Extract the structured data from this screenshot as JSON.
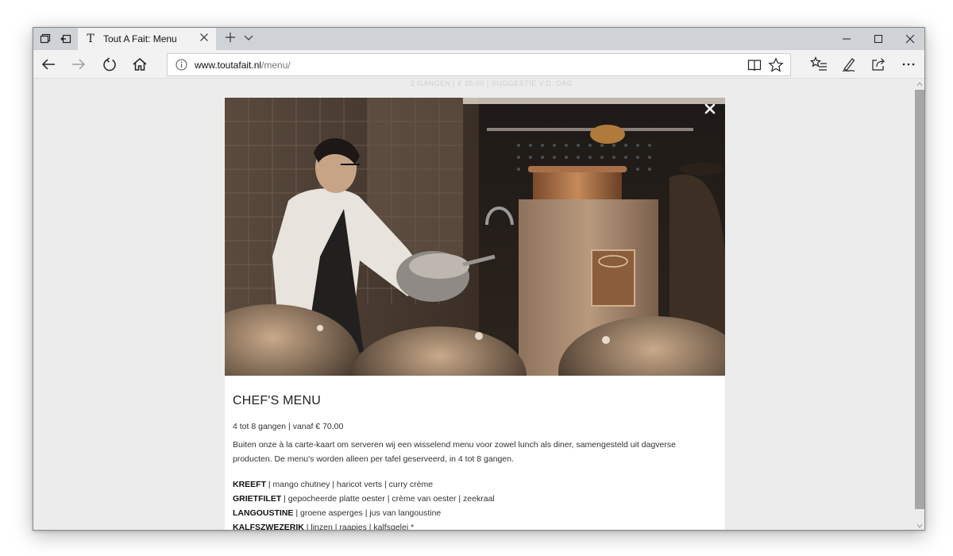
{
  "browser": {
    "tab": {
      "favicon_letter": "T",
      "title": "Tout A Fait: Menu"
    },
    "address": {
      "domain": "www.toutafait.nl",
      "path": "/menu/"
    },
    "icons": {
      "tab_preview": "tab-preview-icon",
      "set_aside": "set-aside-tabs-icon",
      "back": "back-arrow-icon",
      "forward": "forward-arrow-icon",
      "refresh": "refresh-icon",
      "home": "home-icon",
      "info": "info-icon",
      "reading_view": "reading-view-icon",
      "favorite": "star-icon",
      "favorites_hub": "favorites-list-icon",
      "web_note": "pen-icon",
      "share": "share-icon",
      "more": "more-icon"
    }
  },
  "page": {
    "ghost_line": "2 GANGEN | € 35,00 | SUGGESTIE V.D. DAG",
    "modal": {
      "title": "CHEF'S MENU",
      "subtitle": "4 tot 8 gangen | vanaf € 70,00",
      "description": "Buiten onze à la carte-kaart om serveren wij een wisselend menu voor zowel lunch als diner, samengesteld uit dagverse producten. De menu's worden alleen per tafel geserveerd, in 4 tot 8 gangen.",
      "dishes": [
        {
          "name": "KREEFT",
          "details": " | mango chutney | haricot  verts | curry crème"
        },
        {
          "name": "GRIETFILET",
          "details": " | gepocheerde platte oester | crème van oester | zeekraal"
        },
        {
          "name": "LANGOUSTINE",
          "details": " | groene asperges | jus van langoustine"
        },
        {
          "name": "KALFSZWEZERIK",
          "details": " | linzen | raapjes | kalfsgelei *"
        }
      ]
    }
  }
}
